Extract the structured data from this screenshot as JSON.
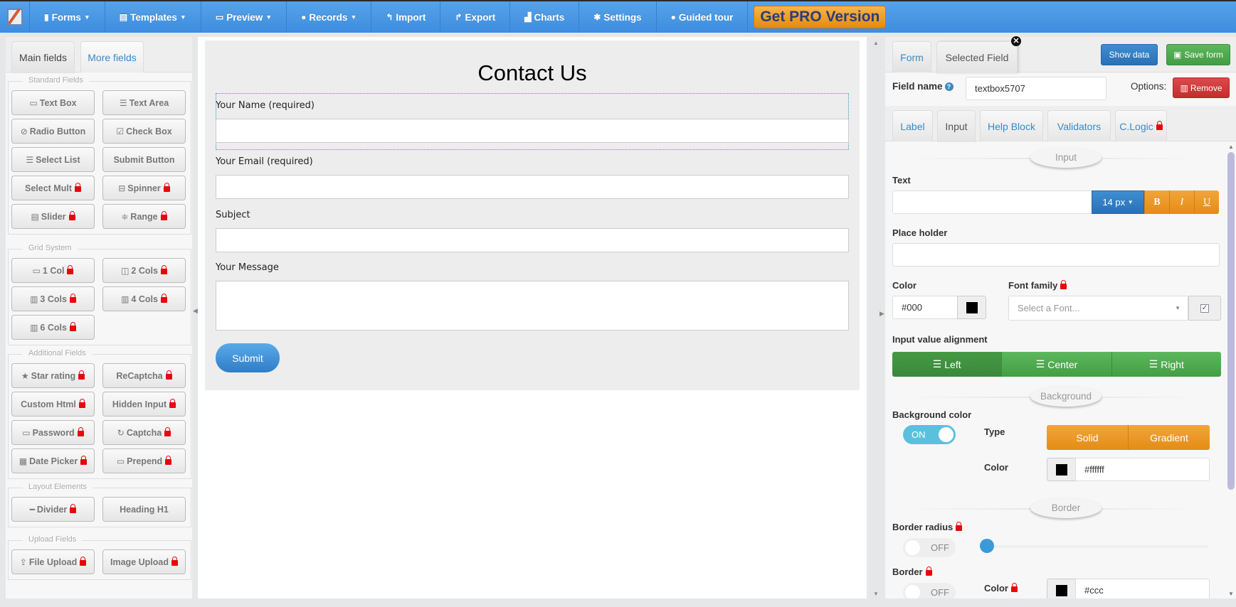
{
  "topbar": {
    "items": [
      {
        "label": "Forms",
        "icon": "file-icon",
        "glyph": "▮",
        "dropdown": true
      },
      {
        "label": "Templates",
        "icon": "template-icon",
        "glyph": "▤",
        "dropdown": true
      },
      {
        "label": "Preview",
        "icon": "monitor-icon",
        "glyph": "▭",
        "dropdown": true
      },
      {
        "label": "Records",
        "icon": "question-circle-icon",
        "glyph": "●",
        "dropdown": true
      },
      {
        "label": "Import",
        "icon": "reply-icon",
        "glyph": "↰",
        "dropdown": false
      },
      {
        "label": "Export",
        "icon": "share-icon",
        "glyph": "↱",
        "dropdown": false
      },
      {
        "label": "Charts",
        "icon": "chart-icon",
        "glyph": "▟",
        "dropdown": false
      },
      {
        "label": "Settings",
        "icon": "gear-icon",
        "glyph": "✱",
        "dropdown": false
      },
      {
        "label": "Guided tour",
        "icon": "question-icon",
        "glyph": "●",
        "dropdown": false
      }
    ],
    "pro_label": "Get PRO Version",
    "caret": "▼"
  },
  "left_panel": {
    "tabs": [
      "Main fields",
      "More fields"
    ],
    "groups": [
      {
        "title": "Standard Fields",
        "buttons": [
          {
            "label": "Text Box",
            "icon": "textbox-icon",
            "glyph": "▭",
            "locked": false
          },
          {
            "label": "Text Area",
            "icon": "textarea-icon",
            "glyph": "☰",
            "locked": false
          },
          {
            "label": "Radio Button",
            "icon": "radio-icon",
            "glyph": "⊘",
            "locked": false
          },
          {
            "label": "Check Box",
            "icon": "checkbox-icon",
            "glyph": "☑",
            "locked": false
          },
          {
            "label": "Select List",
            "icon": "list-icon",
            "glyph": "☰",
            "locked": false
          },
          {
            "label": "Submit Button",
            "icon": "",
            "glyph": "",
            "locked": false
          },
          {
            "label": "Select Mult",
            "icon": "",
            "glyph": "",
            "locked": true
          },
          {
            "label": "Spinner",
            "icon": "spinner-icon",
            "glyph": "⊟",
            "locked": true
          },
          {
            "label": "Slider",
            "icon": "slider-icon",
            "glyph": "▤",
            "locked": true
          },
          {
            "label": "Range",
            "icon": "range-icon",
            "glyph": "≑",
            "locked": true
          }
        ]
      },
      {
        "title": "Grid System",
        "buttons": [
          {
            "label": "1 Col",
            "icon": "one-col-icon",
            "glyph": "▭",
            "locked": true
          },
          {
            "label": "2 Cols",
            "icon": "two-cols-icon",
            "glyph": "◫",
            "locked": true
          },
          {
            "label": "3 Cols",
            "icon": "three-cols-icon",
            "glyph": "▥",
            "locked": true
          },
          {
            "label": "4 Cols",
            "icon": "four-cols-icon",
            "glyph": "▥",
            "locked": true
          },
          {
            "label": "6 Cols",
            "icon": "six-cols-icon",
            "glyph": "▥",
            "locked": true
          }
        ]
      },
      {
        "title": "Additional Fields",
        "buttons": [
          {
            "label": "Star rating",
            "icon": "star-icon",
            "glyph": "★",
            "locked": true
          },
          {
            "label": "ReCaptcha",
            "icon": "",
            "glyph": "",
            "locked": true
          },
          {
            "label": "Custom Html",
            "icon": "",
            "glyph": "",
            "locked": true
          },
          {
            "label": "Hidden Input",
            "icon": "",
            "glyph": "",
            "locked": true
          },
          {
            "label": "Password",
            "icon": "password-icon",
            "glyph": "▭",
            "locked": true
          },
          {
            "label": "Captcha",
            "icon": "refresh-icon",
            "glyph": "↻",
            "locked": true
          },
          {
            "label": "Date Picker",
            "icon": "calendar-icon",
            "glyph": "▦",
            "locked": true
          },
          {
            "label": "Prepend",
            "icon": "prepend-icon",
            "glyph": "▭",
            "locked": true
          }
        ]
      },
      {
        "title": "Layout Elements",
        "buttons": [
          {
            "label": "Divider",
            "icon": "divider-icon",
            "glyph": "━",
            "locked": true
          },
          {
            "label": "Heading H1",
            "icon": "",
            "glyph": "",
            "locked": false
          }
        ]
      },
      {
        "title": "Upload Fields",
        "buttons": [
          {
            "label": "File Upload",
            "icon": "upload-icon",
            "glyph": "⇪",
            "locked": true
          },
          {
            "label": "Image Upload",
            "icon": "",
            "glyph": "",
            "locked": true
          }
        ]
      }
    ]
  },
  "form": {
    "title": "Contact Us",
    "fields": [
      {
        "label": "Your Name (required)",
        "type": "text",
        "value": ""
      },
      {
        "label": "Your Email (required)",
        "type": "text",
        "value": ""
      },
      {
        "label": "Subject",
        "type": "text",
        "value": ""
      },
      {
        "label": "Your Message",
        "type": "textarea",
        "value": ""
      }
    ],
    "submit_label": "Submit"
  },
  "right_panel": {
    "tabs": {
      "form": "Form",
      "selected": "Selected Field"
    },
    "close_glyph": "✕",
    "show_data_label": "Show data",
    "save_form_label": "Save form",
    "save_icon": "▣",
    "field_name_label": "Field name",
    "field_name_value": "textbox5707",
    "options_label": "Options:",
    "remove_label": "Remove",
    "remove_icon": "▥",
    "sub_tabs": [
      {
        "label": "Label",
        "active": false,
        "locked": false
      },
      {
        "label": "Input",
        "active": true,
        "locked": false
      },
      {
        "label": "Help Block",
        "active": false,
        "locked": false
      },
      {
        "label": "Validators",
        "active": false,
        "locked": false
      },
      {
        "label": "C.Logic",
        "active": false,
        "locked": true
      }
    ],
    "sections": {
      "input": "Input",
      "background": "Background",
      "border": "Border"
    },
    "text_label": "Text",
    "text_value": "",
    "font_size": "14 px",
    "format_buttons": [
      "B",
      "I",
      "U"
    ],
    "placeholder_label": "Place holder",
    "placeholder_value": "",
    "color_label": "Color",
    "color_value": "#000",
    "font_family_label": "Font family",
    "font_family_placeholder": "Select a Font...",
    "font_family_checkbox": true,
    "alignment_label": "Input value alignment",
    "alignment_options": [
      "Left",
      "Center",
      "Right"
    ],
    "alignment_selected": "Left",
    "bg_color_label": "Background color",
    "bg_toggle": "ON",
    "type_label": "Type",
    "type_options": [
      "Solid",
      "Gradient"
    ],
    "bg_color_sub_label": "Color",
    "bg_color_value": "#ffffff",
    "border_radius_label": "Border radius",
    "border_radius_toggle": "OFF",
    "border_radius_value": 0,
    "border_label": "Border",
    "border_toggle": "OFF",
    "border_color_label": "Color",
    "border_color_value": "#ccc"
  },
  "colors": {
    "topbar": "#4a98e6",
    "pro_button": "#f0a030",
    "lock": "#e8060c",
    "primary_blue": "#2f7dc8",
    "success_green": "#449d44",
    "danger_red": "#c12e2e",
    "warning_orange": "#e48c15",
    "toggle_on": "#5bc0de"
  }
}
